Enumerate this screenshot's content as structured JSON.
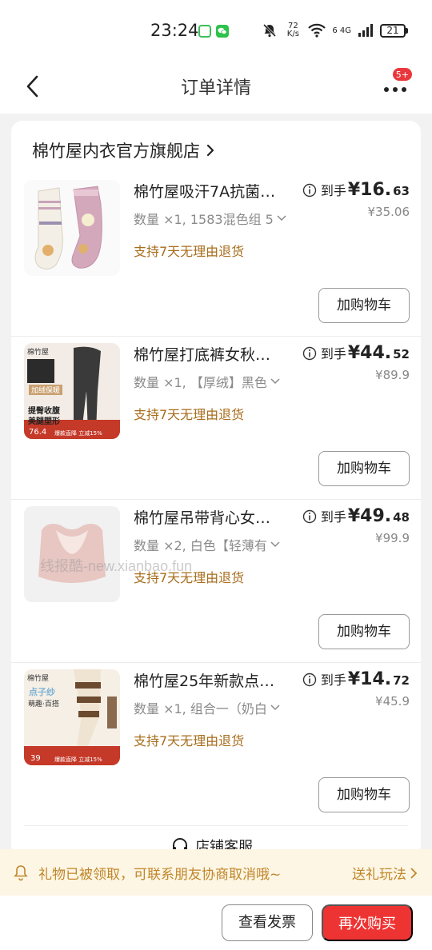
{
  "status_bar": {
    "time": "23:24",
    "net_speed": "72 K/s",
    "network": "6 4G",
    "battery": "21"
  },
  "nav": {
    "title": "订单详情",
    "more_badge": "5+"
  },
  "store": {
    "name": "棉竹屋内衣官方旗舰店"
  },
  "items": [
    {
      "title": "棉竹屋吸汗7A抗菌…",
      "spec": "数量 ×1, 1583混色组 5",
      "service": "支持7天无理由退货",
      "final_label": "到手",
      "final_price_int": "¥16.",
      "final_price_dec": "63",
      "original_price": "¥35.06",
      "add_cart": "加购物车"
    },
    {
      "title": "棉竹屋打底裤女秋…",
      "spec": "数量 ×1, 【厚绒】黑色",
      "service": "支持7天无理由退货",
      "final_label": "到手",
      "final_price_int": "¥44.",
      "final_price_dec": "52",
      "original_price": "¥89.9",
      "add_cart": "加购物车",
      "thumb_text": {
        "brand": "棉竹屋",
        "tag": "加绒保暖",
        "line1": "提臀收腹",
        "line2": "美腿塑形",
        "promo_price": "76.4",
        "promo": "爆款直降 立减15%"
      }
    },
    {
      "title": "棉竹屋吊带背心女…",
      "spec": "数量 ×2, 白色【轻薄有",
      "service": "支持7天无理由退货",
      "final_label": "到手",
      "final_price_int": "¥49.",
      "final_price_dec": "48",
      "original_price": "¥99.9",
      "add_cart": "加购物车"
    },
    {
      "title": "棉竹屋25年新款点…",
      "spec": "数量 ×1, 组合一（奶白",
      "service": "支持7天无理由退货",
      "final_label": "到手",
      "final_price_int": "¥14.",
      "final_price_dec": "72",
      "original_price": "¥45.9",
      "add_cart": "加购物车",
      "thumb_text": {
        "brand": "棉竹屋",
        "tag": "点子纱",
        "line1": "萌趣·百搭",
        "promo_price": "39",
        "promo": "爆款直降 立减15%"
      }
    }
  ],
  "store_service": "店铺客服",
  "watermark": "线报酷-new.xianbao.fun",
  "gift_bar": {
    "text": "礼物已被领取，可联系朋友协商取消哦~",
    "link": "送礼玩法"
  },
  "bottom": {
    "invoice": "查看发票",
    "rebuy": "再次购买"
  },
  "colors": {
    "accent_red": "#ee3433",
    "service_gold": "#a86d1c",
    "gift_text": "#c0862b",
    "gift_bg": "#fdf6e4"
  }
}
